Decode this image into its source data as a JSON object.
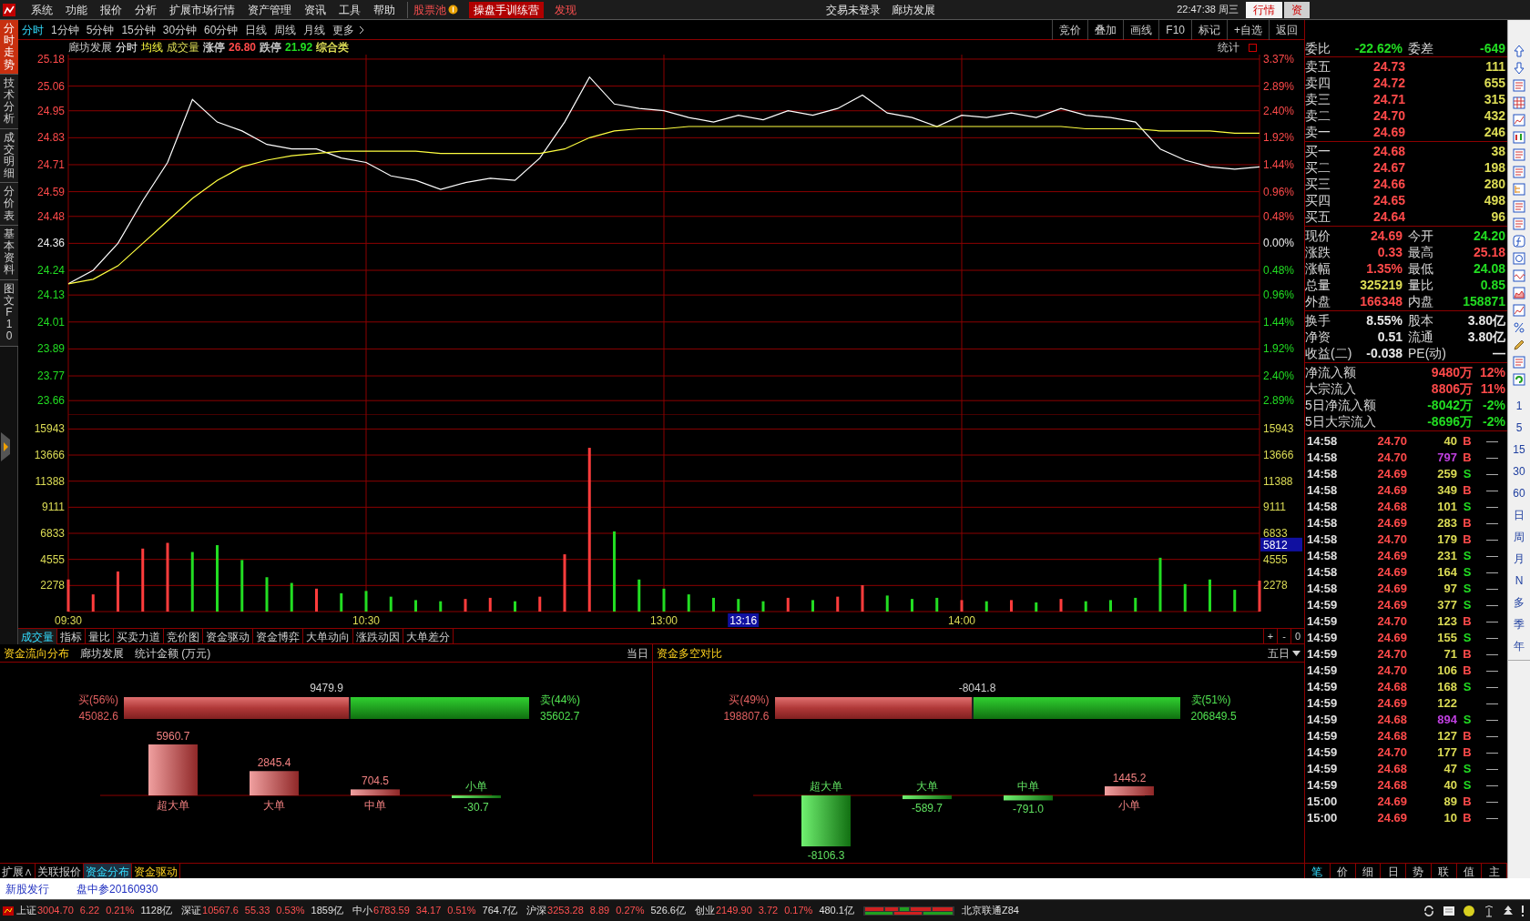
{
  "top_bar": {
    "menu": [
      {
        "label": "系统",
        "kind": "normal"
      },
      {
        "label": "功能",
        "kind": "normal"
      },
      {
        "label": "报价",
        "kind": "normal"
      },
      {
        "label": "分析",
        "kind": "normal"
      },
      {
        "label": "扩展市场行情",
        "kind": "normal"
      },
      {
        "label": "资产管理",
        "kind": "normal"
      },
      {
        "label": "资讯",
        "kind": "normal"
      },
      {
        "label": "工具",
        "kind": "normal"
      },
      {
        "label": "帮助",
        "kind": "normal"
      },
      {
        "label": "股票池",
        "kind": "pool"
      },
      {
        "label": "操盘手训练营",
        "kind": "training"
      },
      {
        "label": "发现",
        "kind": "discover"
      }
    ],
    "login_status": "交易未登录",
    "stock_name": "廊坊发展",
    "clock": "22:47:38",
    "weekday": "周三",
    "view_tabs": [
      {
        "label": "行情",
        "selected": true
      },
      {
        "label": "资",
        "selected": false
      }
    ]
  },
  "side_tabs": [
    {
      "label": "分时走势",
      "selected": true
    },
    {
      "label": "技术分析",
      "selected": false
    },
    {
      "label": "成交明细",
      "selected": false
    },
    {
      "label": "分价表",
      "selected": false
    },
    {
      "label": "基本资料",
      "selected": false
    },
    {
      "label": "图文F10",
      "selected": false
    }
  ],
  "period_tabs": [
    {
      "label": "分时",
      "selected": true
    },
    {
      "label": "1分钟",
      "selected": false
    },
    {
      "label": "5分钟",
      "selected": false
    },
    {
      "label": "15分钟",
      "selected": false
    },
    {
      "label": "30分钟",
      "selected": false
    },
    {
      "label": "60分钟",
      "selected": false
    },
    {
      "label": "日线",
      "selected": false
    },
    {
      "label": "周线",
      "selected": false
    },
    {
      "label": "月线",
      "selected": false
    },
    {
      "label": "更多",
      "selected": false
    }
  ],
  "chart_tools": [
    "竞价",
    "叠加",
    "画线",
    "F10",
    "标记",
    "+自选",
    "返回"
  ],
  "price_chart": {
    "stock": "廊坊发展",
    "legend": [
      {
        "text": "涨停",
        "color": "#c8c8c8"
      },
      {
        "text": "26.80",
        "color": "#ff4a4a"
      },
      {
        "text": "跌停",
        "color": "#c8c8c8"
      },
      {
        "text": "21.92",
        "color": "#22dd22"
      },
      {
        "text": "综合类",
        "color": "#dcdc55"
      }
    ],
    "stat_label": "统计",
    "percent_labels": [
      "3.37%",
      "2.89%",
      "2.40%",
      "1.92%",
      "1.44%",
      "0.96%",
      "0.48%",
      "0.00%",
      "0.48%",
      "0.96%",
      "1.44%",
      "1.92%",
      "2.40%",
      "2.89%"
    ],
    "chart_data": {
      "type": "line",
      "grid": true,
      "series": [
        {
          "name": "分时",
          "color": "#ffffff",
          "values": [
            24.18,
            24.24,
            24.36,
            24.55,
            24.72,
            25.0,
            24.9,
            24.86,
            24.8,
            24.78,
            24.78,
            24.74,
            24.72,
            24.66,
            24.64,
            24.6,
            24.63,
            24.65,
            24.64,
            24.74,
            24.9,
            25.1,
            24.98,
            24.96,
            24.95,
            24.92,
            24.9,
            24.93,
            24.91,
            24.95,
            24.93,
            24.96,
            25.02,
            24.94,
            24.92,
            24.88,
            24.93,
            24.92,
            24.94,
            24.92,
            24.96,
            24.93,
            24.92,
            24.9,
            24.78,
            24.73,
            24.7,
            24.69,
            24.7
          ]
        },
        {
          "name": "均线",
          "color": "#ffff40",
          "values": [
            24.18,
            24.2,
            24.26,
            24.36,
            24.46,
            24.56,
            24.64,
            24.7,
            24.73,
            24.75,
            24.76,
            24.77,
            24.77,
            24.77,
            24.77,
            24.76,
            24.76,
            24.76,
            24.76,
            24.76,
            24.78,
            24.83,
            24.86,
            24.87,
            24.87,
            24.88,
            24.88,
            24.88,
            24.88,
            24.88,
            24.88,
            24.88,
            24.88,
            24.88,
            24.88,
            24.88,
            24.88,
            24.88,
            24.88,
            24.88,
            24.88,
            24.87,
            24.87,
            24.87,
            24.86,
            24.86,
            24.86,
            24.85,
            24.85
          ]
        }
      ],
      "ylim": [
        23.6,
        25.2
      ],
      "yticks": [
        {
          "value": 25.18,
          "label": "25.18"
        },
        {
          "value": 25.06,
          "label": "25.06"
        },
        {
          "value": 24.95,
          "label": "24.95"
        },
        {
          "value": 24.83,
          "label": "24.83"
        },
        {
          "value": 24.71,
          "label": "24.71"
        },
        {
          "value": 24.59,
          "label": "24.59"
        },
        {
          "value": 24.48,
          "label": "24.48"
        },
        {
          "value": 24.36,
          "label": "24.36"
        },
        {
          "value": 24.24,
          "label": "24.24"
        },
        {
          "value": 24.13,
          "label": "24.13"
        },
        {
          "value": 24.01,
          "label": "24.01"
        },
        {
          "value": 23.89,
          "label": "23.89"
        },
        {
          "value": 23.77,
          "label": "23.77"
        },
        {
          "value": 23.66,
          "label": "23.66"
        }
      ]
    }
  },
  "volume_chart": {
    "cursor": {
      "time": "13:16",
      "value": "5812"
    },
    "chart_data": {
      "type": "bar",
      "grid": true,
      "categories": [
        "09:30",
        null,
        null,
        null,
        null,
        null,
        null,
        null,
        null,
        null,
        null,
        null,
        "10:30",
        null,
        null,
        null,
        null,
        null,
        null,
        null,
        null,
        null,
        null,
        null,
        "13:00",
        null,
        null,
        null,
        null,
        null,
        null,
        null,
        null,
        null,
        null,
        null,
        "14:00",
        null,
        null,
        null,
        null,
        null,
        null,
        null,
        null,
        null,
        null,
        null,
        null
      ],
      "series": [
        {
          "name": "成交量",
          "color": "#ff3c3c",
          "values": [
            2800,
            1500,
            3500,
            5500,
            6000,
            null,
            null,
            null,
            null,
            null,
            2000,
            null,
            null,
            null,
            null,
            null,
            1100,
            1200,
            null,
            1300,
            5000,
            14300,
            null,
            null,
            null,
            null,
            null,
            null,
            null,
            1200,
            null,
            1300,
            2300,
            null,
            null,
            null,
            1000,
            null,
            1000,
            null,
            1100,
            null,
            null,
            null,
            null,
            null,
            null,
            null,
            2700
          ]
        },
        {
          "color": "#22dd22",
          "values": [
            null,
            null,
            null,
            null,
            null,
            5200,
            5800,
            4500,
            3000,
            2500,
            null,
            1600,
            1800,
            1300,
            1000,
            900,
            null,
            null,
            900,
            null,
            null,
            null,
            7000,
            2800,
            2000,
            1500,
            1200,
            1100,
            900,
            null,
            1000,
            null,
            null,
            1400,
            1100,
            1200,
            null,
            900,
            null,
            800,
            null,
            900,
            1000,
            1200,
            4700,
            2400,
            2800,
            1900,
            null
          ]
        }
      ],
      "ylim": [
        0,
        17085
      ],
      "yticks": [
        {
          "value": 15943,
          "label": "15943"
        },
        {
          "value": 13666,
          "label": "13666"
        },
        {
          "value": 11388,
          "label": "11388"
        },
        {
          "value": 9111,
          "label": "9111"
        },
        {
          "value": 6833,
          "label": "6833"
        },
        {
          "value": 4555,
          "label": "4555"
        },
        {
          "value": 2278,
          "label": "2278"
        }
      ]
    }
  },
  "indicator_tabs": [
    {
      "label": "成交量",
      "selected": true
    },
    {
      "label": "指标",
      "selected": false
    },
    {
      "label": "量比",
      "selected": false
    },
    {
      "label": "买卖力道",
      "selected": false
    },
    {
      "label": "竞价图",
      "selected": false
    },
    {
      "label": "资金驱动",
      "selected": false
    },
    {
      "label": "资金博弈",
      "selected": false
    },
    {
      "label": "大单动向",
      "selected": false
    },
    {
      "label": "涨跌动因",
      "selected": false
    },
    {
      "label": "大单差分",
      "selected": false
    }
  ],
  "zoom_controls": [
    "+",
    "-",
    "0"
  ],
  "fund_panels": [
    {
      "title": "资金流向分布",
      "stock": "廊坊发展",
      "unit": "统计金额 (万元)",
      "period": "当日",
      "dropdown": false,
      "split": {
        "buy_label": "买(56%)",
        "buy_amount": "45082.6",
        "net": "9479.9",
        "sell_label": "卖(44%)",
        "sell_amount": "35602.7",
        "level": 0.56
      },
      "chart_data": {
        "type": "bar",
        "categories": [
          "超大单",
          "大单",
          "中单",
          "小单"
        ],
        "values": [
          5960.7,
          2845.4,
          704.5,
          -30.7
        ],
        "value_labels": [
          "5960.7",
          "2845.4",
          "704.5",
          "-30.7"
        ]
      }
    },
    {
      "title": "资金多空对比",
      "period": "五日",
      "dropdown": true,
      "split": {
        "buy_label": "买(49%)",
        "buy_amount": "198807.6",
        "net": "-8041.8",
        "sell_label": "卖(51%)",
        "sell_amount": "206849.5",
        "level": 0.49
      },
      "chart_data": {
        "type": "bar",
        "categories": [
          "超大单",
          "大单",
          "中单",
          "小单"
        ],
        "values": [
          -8106.3,
          -589.7,
          -791.0,
          1445.2
        ],
        "value_labels": [
          "-8106.3",
          "-589.7",
          "-791.0",
          "1445.2"
        ]
      }
    }
  ],
  "bottom_tabs": [
    {
      "label": "扩展∧",
      "selected": false,
      "kind": "tab"
    },
    {
      "label": "关联报价",
      "selected": false,
      "kind": "tab"
    },
    {
      "label": "资金分布",
      "selected": true,
      "kind": "tab"
    },
    {
      "label": "资金驱动",
      "selected": false,
      "kind": "featured"
    }
  ],
  "quote_panel": {
    "ratio": [
      {
        "label": "委比",
        "value": "-22.62%",
        "color": "#22dd22"
      },
      {
        "label": "委差",
        "value": "-649",
        "color": "#22dd22"
      }
    ],
    "asks": [
      {
        "label": "卖五",
        "price": "24.73",
        "volume": "111"
      },
      {
        "label": "卖四",
        "price": "24.72",
        "volume": "655"
      },
      {
        "label": "卖三",
        "price": "24.71",
        "volume": "315"
      },
      {
        "label": "卖二",
        "price": "24.70",
        "volume": "432"
      },
      {
        "label": "卖一",
        "price": "24.69",
        "volume": "246"
      }
    ],
    "bids": [
      {
        "label": "买一",
        "price": "24.68",
        "volume": "38"
      },
      {
        "label": "买二",
        "price": "24.67",
        "volume": "198"
      },
      {
        "label": "买三",
        "price": "24.66",
        "volume": "280"
      },
      {
        "label": "买四",
        "price": "24.65",
        "volume": "498"
      },
      {
        "label": "买五",
        "price": "24.64",
        "volume": "96"
      }
    ],
    "stats": [
      [
        {
          "label": "现价",
          "value": "24.69",
          "color": "#ff4a4a"
        },
        {
          "label": "今开",
          "value": "24.20",
          "color": "#22dd22"
        }
      ],
      [
        {
          "label": "涨跌",
          "value": "0.33",
          "color": "#ff4a4a"
        },
        {
          "label": "最高",
          "value": "25.18",
          "color": "#ff4a4a"
        }
      ],
      [
        {
          "label": "涨幅",
          "value": "1.35%",
          "color": "#ff4a4a"
        },
        {
          "label": "最低",
          "value": "24.08",
          "color": "#22dd22"
        }
      ],
      [
        {
          "label": "总量",
          "value": "325219",
          "color": "#dcdc55"
        },
        {
          "label": "量比",
          "value": "0.85",
          "color": "#22dd22"
        }
      ],
      [
        {
          "label": "外盘",
          "value": "166348",
          "color": "#ff4a4a"
        },
        {
          "label": "内盘",
          "value": "158871",
          "color": "#22dd22"
        }
      ]
    ],
    "fundamentals": [
      [
        {
          "label": "换手",
          "value": "8.55%"
        },
        {
          "label": "股本",
          "value": "3.80亿"
        }
      ],
      [
        {
          "label": "净资",
          "value": "0.51"
        },
        {
          "label": "流通",
          "value": "3.80亿"
        }
      ],
      [
        {
          "label": "收益(二)",
          "value": "-0.038"
        },
        {
          "label": "PE(动)",
          "value": "—"
        }
      ]
    ],
    "flows": [
      {
        "label": "净流入额",
        "amount": "9480万",
        "pct": "12%",
        "color": "#ff4a4a"
      },
      {
        "label": "大宗流入",
        "amount": "8806万",
        "pct": "11%",
        "color": "#ff4a4a"
      },
      {
        "label": "5日净流入额",
        "amount": "-8042万",
        "pct": "-2%",
        "color": "#22dd22"
      },
      {
        "label": "5日大宗流入",
        "amount": "-8696万",
        "pct": "-2%",
        "color": "#22dd22"
      }
    ]
  },
  "trades": [
    {
      "time": "14:58",
      "price": "24.70",
      "volume": "40",
      "big": false,
      "kind": "buy",
      "side": "B",
      "flag": "—"
    },
    {
      "time": "14:58",
      "price": "24.70",
      "volume": "797",
      "big": true,
      "kind": "buy",
      "side": "B",
      "flag": "—"
    },
    {
      "time": "14:58",
      "price": "24.69",
      "volume": "259",
      "big": false,
      "kind": "sell",
      "side": "S",
      "flag": "—"
    },
    {
      "time": "14:58",
      "price": "24.69",
      "volume": "349",
      "big": false,
      "kind": "buy",
      "side": "B",
      "flag": "—"
    },
    {
      "time": "14:58",
      "price": "24.68",
      "volume": "101",
      "big": false,
      "kind": "sell",
      "side": "S",
      "flag": "—"
    },
    {
      "time": "14:58",
      "price": "24.69",
      "volume": "283",
      "big": false,
      "kind": "buy",
      "side": "B",
      "flag": "—"
    },
    {
      "time": "14:58",
      "price": "24.70",
      "volume": "179",
      "big": false,
      "kind": "buy",
      "side": "B",
      "flag": "—"
    },
    {
      "time": "14:58",
      "price": "24.69",
      "volume": "231",
      "big": false,
      "kind": "sell",
      "side": "S",
      "flag": "—"
    },
    {
      "time": "14:58",
      "price": "24.69",
      "volume": "164",
      "big": false,
      "kind": "sell",
      "side": "S",
      "flag": "—"
    },
    {
      "time": "14:58",
      "price": "24.69",
      "volume": "97",
      "big": false,
      "kind": "sell",
      "side": "S",
      "flag": "—"
    },
    {
      "time": "14:59",
      "price": "24.69",
      "volume": "377",
      "big": false,
      "kind": "sell",
      "side": "S",
      "flag": "—"
    },
    {
      "time": "14:59",
      "price": "24.70",
      "volume": "123",
      "big": false,
      "kind": "buy",
      "side": "B",
      "flag": "—"
    },
    {
      "time": "14:59",
      "price": "24.69",
      "volume": "155",
      "big": false,
      "kind": "sell",
      "side": "S",
      "flag": "—"
    },
    {
      "time": "14:59",
      "price": "24.70",
      "volume": "71",
      "big": false,
      "kind": "buy",
      "side": "B",
      "flag": "—"
    },
    {
      "time": "14:59",
      "price": "24.70",
      "volume": "106",
      "big": false,
      "kind": "buy",
      "side": "B",
      "flag": "—"
    },
    {
      "time": "14:59",
      "price": "24.68",
      "volume": "168",
      "big": false,
      "kind": "sell",
      "side": "S",
      "flag": "—"
    },
    {
      "time": "14:59",
      "price": "24.69",
      "volume": "122",
      "big": false,
      "kind": "neutral",
      "flag": "—"
    },
    {
      "time": "14:59",
      "price": "24.68",
      "volume": "894",
      "big": true,
      "kind": "sell",
      "side": "S",
      "flag": "—"
    },
    {
      "time": "14:59",
      "price": "24.68",
      "volume": "127",
      "big": false,
      "kind": "buy",
      "side": "B",
      "flag": "—"
    },
    {
      "time": "14:59",
      "price": "24.70",
      "volume": "177",
      "big": false,
      "kind": "buy",
      "side": "B",
      "flag": "—"
    },
    {
      "time": "14:59",
      "price": "24.68",
      "volume": "47",
      "big": false,
      "kind": "sell",
      "side": "S",
      "flag": "—"
    },
    {
      "time": "14:59",
      "price": "24.68",
      "volume": "40",
      "big": false,
      "kind": "sell",
      "side": "S",
      "flag": "—"
    },
    {
      "time": "15:00",
      "price": "24.69",
      "volume": "89",
      "big": false,
      "kind": "buy",
      "side": "B",
      "flag": "—"
    },
    {
      "time": "15:00",
      "price": "24.69",
      "volume": "10",
      "big": false,
      "kind": "buy",
      "side": "B",
      "flag": "—"
    }
  ],
  "trade_tabs": [
    {
      "label": "笔",
      "selected": true
    },
    {
      "label": "价",
      "selected": false
    },
    {
      "label": "细",
      "selected": false
    },
    {
      "label": "日",
      "selected": false
    },
    {
      "label": "势",
      "selected": false
    },
    {
      "label": "联",
      "selected": false
    },
    {
      "label": "值",
      "selected": false
    },
    {
      "label": "主",
      "selected": false
    }
  ],
  "period_shortcuts": [
    "1",
    "5",
    "15",
    "30",
    "60",
    "日",
    "周",
    "月",
    "N",
    "多",
    "季",
    "年"
  ],
  "news_bar": [
    "新股发行",
    "盘中参20160930"
  ],
  "status_bar": {
    "indices": [
      {
        "name": "上证",
        "value": "3004.70",
        "change": "6.22",
        "pct": "0.21%",
        "amount": "1128亿"
      },
      {
        "name": "深证",
        "value": "10567.6",
        "change": "55.33",
        "pct": "0.53%",
        "amount": "1859亿"
      },
      {
        "name": "中小",
        "value": "6783.59",
        "change": "34.17",
        "pct": "0.51%",
        "amount": "764.7亿"
      },
      {
        "name": "沪深",
        "value": "3253.28",
        "change": "8.89",
        "pct": "0.27%",
        "amount": "526.6亿"
      },
      {
        "name": "创业",
        "value": "2149.90",
        "change": "3.72",
        "pct": "0.17%",
        "amount": "480.1亿"
      }
    ],
    "server": "北京联通Z84"
  }
}
